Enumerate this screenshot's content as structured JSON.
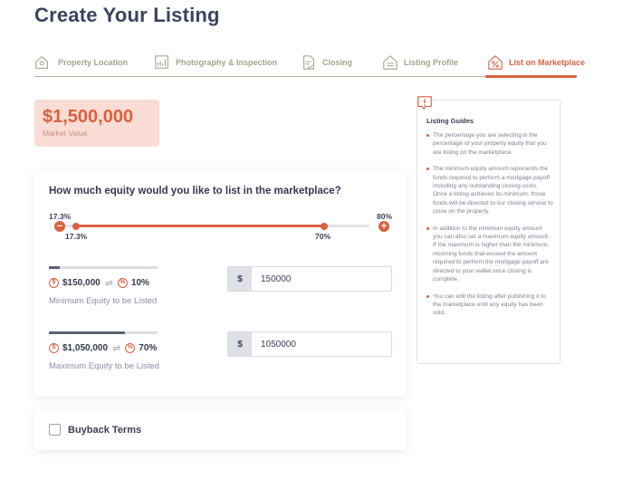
{
  "page": {
    "title": "Create Your Listing"
  },
  "steps": [
    {
      "label": "Property Location",
      "icon": "house-pin-icon"
    },
    {
      "label": "Photography & Inspection",
      "icon": "photo-chart-icon"
    },
    {
      "label": "Closing",
      "icon": "document-check-icon"
    },
    {
      "label": "Listing Profile",
      "icon": "house-profile-icon"
    },
    {
      "label": "List on Marketplace",
      "icon": "house-percent-icon"
    }
  ],
  "active_step": 4,
  "market_value": {
    "amount": "$1,500,000",
    "label": "Market Value"
  },
  "equity": {
    "question": "How much equity would you like to list in the marketplace?",
    "range": {
      "min_label": "17.3%",
      "max_label": "80%",
      "low_label": "17.3%",
      "high_label": "70%",
      "min": 17.3,
      "max": 80,
      "low": 17.3,
      "high": 70
    },
    "minimum": {
      "amount": "$150,000",
      "percent": "10%",
      "label": "Minimum Equity to be Listed",
      "currency": "$",
      "value": "150000",
      "bar_fraction": 0.1
    },
    "maximum": {
      "amount": "$1,050,000",
      "percent": "70%",
      "label": "Maximum Equity to be Listed",
      "currency": "$",
      "value": "1050000",
      "bar_fraction": 0.7
    }
  },
  "buyback": {
    "label": "Buyback Terms",
    "checked": false
  },
  "guides": {
    "title": "Listing Guides",
    "items": [
      "The percentage you are selecting is the percentage of your property equity that you are listing on the marketplace.",
      "The minimum equity amount represents the funds required to perform a mortgage payoff including any outstanding closing costs. Once a listing achieves its minimum, those funds will be directed to our closing service to close on the property.",
      "In addition to the minimum equity amount you can also set a maximum equity amount. If the maximum is higher than the minimum, incoming funds that exceed the amount required to perform the mortgage payoff are directed to your wallet once closing is complete.",
      "You can edit the listing after publishing it to the marketplace until any equity has been sold."
    ]
  },
  "colors": {
    "accent": "#d9613f",
    "title": "#3b4260",
    "step_inactive": "#a7a38a",
    "market_bg": "#f9dcd3"
  }
}
